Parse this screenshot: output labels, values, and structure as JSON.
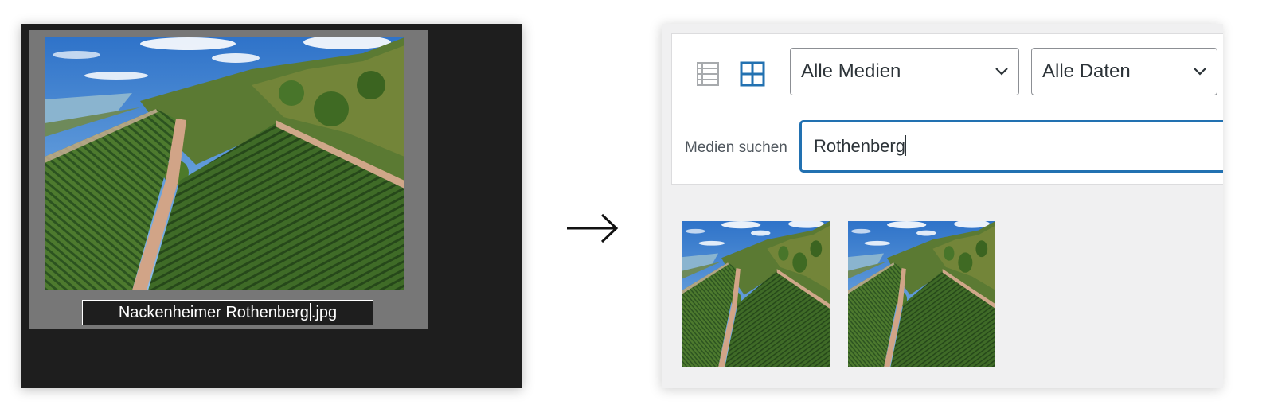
{
  "explorer": {
    "thumbnail_icon": "vineyard-photo",
    "rename_value_before_caret": "Nackenheimer Rothenberg",
    "rename_value_after_caret": ".jpg"
  },
  "arrow_icon": "right-arrow",
  "media_library": {
    "view_modes": [
      "list-view-icon",
      "grid-view-icon"
    ],
    "active_view": "grid",
    "filter_type": "Alle Medien",
    "filter_date": "Alle Daten",
    "search_label": "Medien suchen",
    "search_value": "Rothenberg",
    "results": [
      {
        "icon": "vineyard-photo"
      },
      {
        "icon": "vineyard-photo"
      }
    ]
  },
  "colors": {
    "accent": "#2271b1",
    "explorer_bg": "#1e1e1e",
    "media_bg": "#f0f0f1"
  }
}
